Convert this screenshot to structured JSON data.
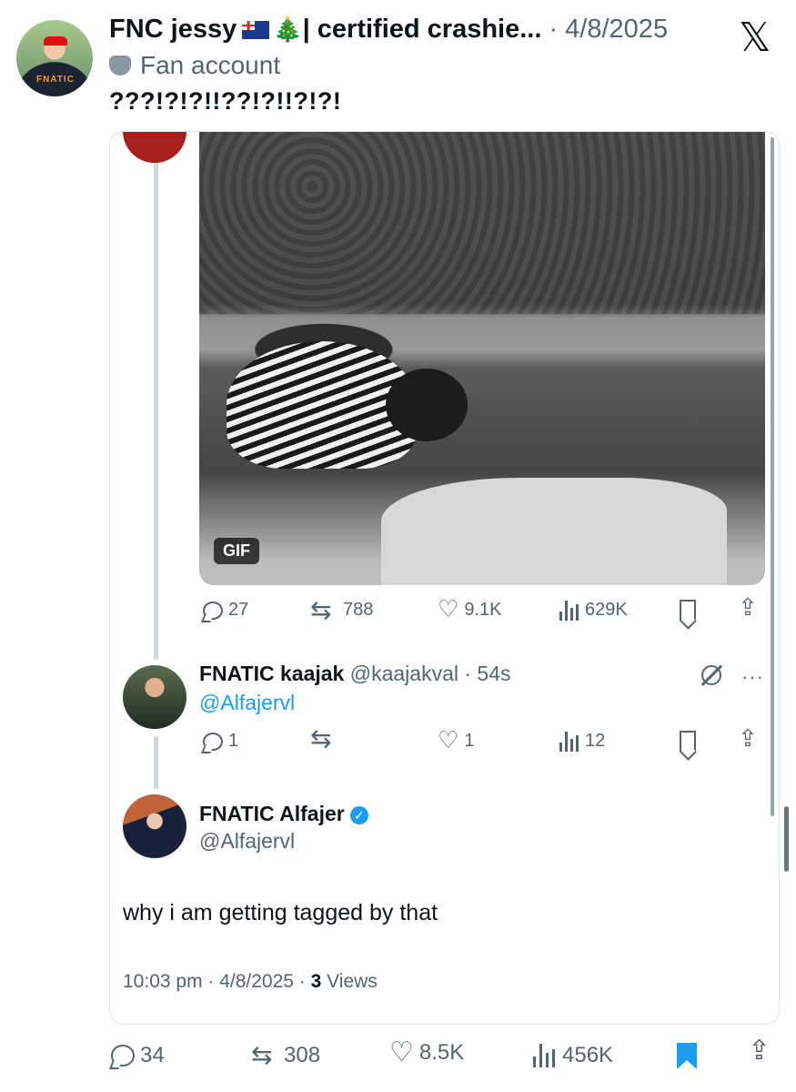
{
  "x_logo": "𝕏",
  "header": {
    "name_prefix": "FNC jessy",
    "name_suffix": "| certified crashie...",
    "date": "· 4/8/2025",
    "fan_label": "Fan account",
    "tweet_text": "???!?!?!!??!?!!?!?!"
  },
  "gif": {
    "badge": "GIF"
  },
  "gif_stats": {
    "replies": "27",
    "reposts": "788",
    "likes": "9.1K",
    "views": "629K"
  },
  "reply": {
    "name": "FNATIC kaajak",
    "handle_time": "@kaajakval · 54s",
    "mention": "@Alfajervl",
    "menu": "···",
    "stats": {
      "replies": "1",
      "reposts": "",
      "likes": "1",
      "views": "12"
    }
  },
  "quoted": {
    "name": "FNATIC Alfajer",
    "handle": "@Alfajervl",
    "text": "why i am getting tagged by that",
    "time_date": "10:03 pm · 4/8/2025 · ",
    "views_count": "3",
    "views_label": " Views"
  },
  "bottom_stats": {
    "replies": "34",
    "reposts": "308",
    "likes": "8.5K",
    "views": "456K"
  },
  "colors": {
    "accent": "#1d9bf0",
    "muted": "#536471",
    "text": "#0f1419"
  }
}
